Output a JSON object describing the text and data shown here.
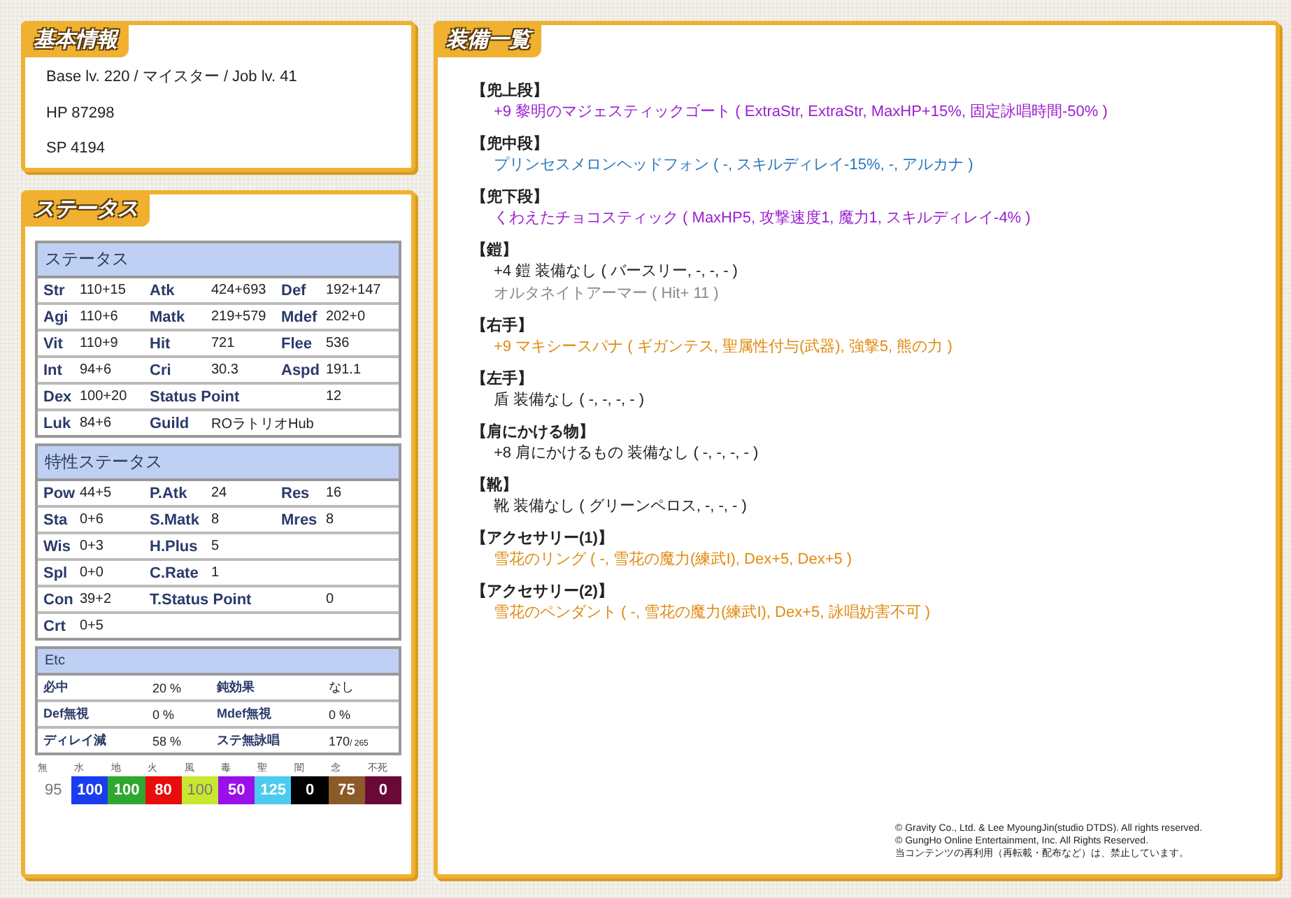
{
  "basic": {
    "title": "基本情報",
    "lines": [
      "Base lv. 220 / マイスター / Job lv. 41",
      "HP 87298",
      "SP 4194"
    ]
  },
  "status_panel": {
    "title": "ステータス",
    "tables": [
      {
        "heading": "ステータス",
        "rows": [
          [
            {
              "label": "Str",
              "value": "110+15"
            },
            {
              "label": "Atk",
              "value": "424+693"
            },
            {
              "label": "Def",
              "value": "192+147"
            }
          ],
          [
            {
              "label": "Agi",
              "value": "110+6"
            },
            {
              "label": "Matk",
              "value": "219+579"
            },
            {
              "label": "Mdef",
              "value": "202+0"
            }
          ],
          [
            {
              "label": "Vit",
              "value": "110+9"
            },
            {
              "label": "Hit",
              "value": "721"
            },
            {
              "label": "Flee",
              "value": "536"
            }
          ],
          [
            {
              "label": "Int",
              "value": "94+6"
            },
            {
              "label": "Cri",
              "value": "30.3"
            },
            {
              "label": "Aspd",
              "value": "191.1"
            }
          ],
          [
            {
              "label": "Dex",
              "value": "100+20"
            },
            {
              "label": "Status Point",
              "value": "12",
              "wide": true
            }
          ],
          [
            {
              "label": "Luk",
              "value": "84+6"
            },
            {
              "label": "Guild",
              "value": "ROラトリオHub"
            }
          ]
        ]
      },
      {
        "heading": "特性ステータス",
        "rows": [
          [
            {
              "label": "Pow",
              "value": "44+5"
            },
            {
              "label": "P.Atk",
              "value": "24"
            },
            {
              "label": "Res",
              "value": "16"
            }
          ],
          [
            {
              "label": "Sta",
              "value": "0+6"
            },
            {
              "label": "S.Matk",
              "value": "8"
            },
            {
              "label": "Mres",
              "value": "8"
            }
          ],
          [
            {
              "label": "Wis",
              "value": "0+3"
            },
            {
              "label": "H.Plus",
              "value": "5"
            }
          ],
          [
            {
              "label": "Spl",
              "value": "0+0"
            },
            {
              "label": "C.Rate",
              "value": "1"
            }
          ],
          [
            {
              "label": "Con",
              "value": "39+2"
            },
            {
              "label": "T.Status Point",
              "value": "0",
              "wide": true
            }
          ],
          [
            {
              "label": "Crt",
              "value": "0+5"
            }
          ]
        ]
      }
    ],
    "etc": {
      "heading": "Etc",
      "rows": [
        [
          {
            "label": "必中",
            "value": "20 %"
          },
          {
            "label": "鈍効果",
            "value": "なし"
          }
        ],
        [
          {
            "label": "Def無視",
            "value": "0 %"
          },
          {
            "label": "Mdef無視",
            "value": "0 %"
          }
        ],
        [
          {
            "label": "ディレイ減",
            "value": "58 %"
          },
          {
            "label": "ステ無詠唱",
            "value": "170",
            "note": "/ 265"
          }
        ]
      ]
    },
    "elements": [
      {
        "label": "無",
        "value": "95",
        "color": "#ffffff"
      },
      {
        "label": "水",
        "value": "100",
        "color": "#1a3cf0"
      },
      {
        "label": "地",
        "value": "100",
        "color": "#2ea82e"
      },
      {
        "label": "火",
        "value": "80",
        "color": "#e80c0c"
      },
      {
        "label": "風",
        "value": "100",
        "color": "#c8e830"
      },
      {
        "label": "毒",
        "value": "50",
        "color": "#9a10e8"
      },
      {
        "label": "聖",
        "value": "125",
        "color": "#4ccaf0"
      },
      {
        "label": "闇",
        "value": "0",
        "color": "#000000"
      },
      {
        "label": "念",
        "value": "75",
        "color": "#8a5a28"
      },
      {
        "label": "不死",
        "value": "0",
        "color": "#6a0838"
      }
    ]
  },
  "equipment": {
    "title": "装備一覧",
    "slots": [
      {
        "slot": "【兜上段】",
        "items": [
          {
            "text": "+9 黎明のマジェスティックゴート ( ExtraStr, ExtraStr, MaxHP+15%, 固定詠唱時間-50% )",
            "color": "#9b1fd0"
          }
        ]
      },
      {
        "slot": "【兜中段】",
        "items": [
          {
            "text": "プリンセスメロンヘッドフォン ( -, スキルディレイ-15%, -, アルカナ )",
            "color": "#2a78c0"
          }
        ]
      },
      {
        "slot": "【兜下段】",
        "items": [
          {
            "text": "くわえたチョコスティック ( MaxHP5, 攻撃速度1, 魔力1, スキルディレイ-4% )",
            "color": "#9b1fd0"
          }
        ]
      },
      {
        "slot": "【鎧】",
        "items": [
          {
            "text": "+4 鎧 装備なし ( バースリー, -, -, - )",
            "color": "#222222"
          },
          {
            "text": "オルタネイトアーマー ( Hit+ 11 )",
            "color": "#8a8a8a"
          }
        ]
      },
      {
        "slot": "【右手】",
        "items": [
          {
            "text": "+9 マキシースパナ ( ギガンテス, 聖属性付与(武器), 強撃5, 熊の力 )",
            "color": "#e08a10"
          }
        ]
      },
      {
        "slot": "【左手】",
        "items": [
          {
            "text": "盾 装備なし ( -, -, -, - )",
            "color": "#222222"
          }
        ]
      },
      {
        "slot": "【肩にかける物】",
        "items": [
          {
            "text": "+8 肩にかけるもの 装備なし ( -, -, -, - )",
            "color": "#222222"
          }
        ]
      },
      {
        "slot": "【靴】",
        "items": [
          {
            "text": "靴 装備なし ( グリーンペロス, -, -, - )",
            "color": "#222222"
          }
        ]
      },
      {
        "slot": "【アクセサリー(1)】",
        "items": [
          {
            "text": "雪花のリング ( -, 雪花の魔力(練武I), Dex+5, Dex+5 )",
            "color": "#e08a10"
          }
        ]
      },
      {
        "slot": "【アクセサリー(2)】",
        "items": [
          {
            "text": "雪花のペンダント ( -, 雪花の魔力(練武I), Dex+5, 詠唱妨害不可 )",
            "color": "#e08a10"
          }
        ]
      }
    ],
    "copyright": [
      "© Gravity Co., Ltd. & Lee MyoungJin(studio DTDS). All rights reserved.",
      "© GungHo Online Entertainment, Inc. All Rights Reserved.",
      "当コンテンツの再利用（再転載・配布など）は、禁止しています。"
    ]
  }
}
